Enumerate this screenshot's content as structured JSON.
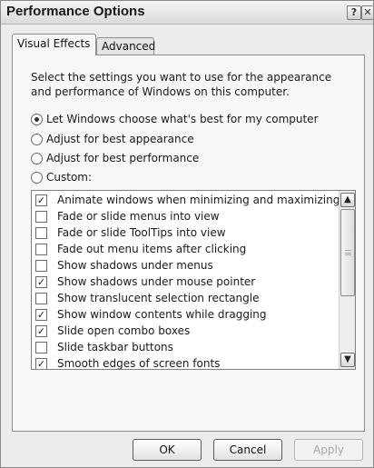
{
  "window": {
    "title": "Performance Options",
    "help_glyph": "?",
    "close_glyph": "✕"
  },
  "tabs": [
    {
      "label": "Visual Effects",
      "active": true
    },
    {
      "label": "Advanced",
      "active": false
    }
  ],
  "visual_effects": {
    "description": "Select the settings you want to use for the appearance and performance of Windows on this computer.",
    "options": [
      {
        "label": "Let Windows choose what's best for my computer",
        "selected": true
      },
      {
        "label": "Adjust for best appearance",
        "selected": false
      },
      {
        "label": "Adjust for best performance",
        "selected": false
      },
      {
        "label": "Custom:",
        "selected": false
      }
    ],
    "effects": [
      {
        "label": "Animate windows when minimizing and maximizing",
        "checked": true
      },
      {
        "label": "Fade or slide menus into view",
        "checked": false
      },
      {
        "label": "Fade or slide ToolTips into view",
        "checked": false
      },
      {
        "label": "Fade out menu items after clicking",
        "checked": false
      },
      {
        "label": "Show shadows under menus",
        "checked": false
      },
      {
        "label": "Show shadows under mouse pointer",
        "checked": true
      },
      {
        "label": "Show translucent selection rectangle",
        "checked": false
      },
      {
        "label": "Show window contents while dragging",
        "checked": true
      },
      {
        "label": "Slide open combo boxes",
        "checked": true
      },
      {
        "label": "Slide taskbar buttons",
        "checked": false
      },
      {
        "label": "Smooth edges of screen fonts",
        "checked": true
      }
    ],
    "scrollbar": {
      "up_glyph": "▲",
      "down_glyph": "▼"
    }
  },
  "buttons": {
    "ok": "OK",
    "cancel": "Cancel",
    "apply": "Apply",
    "apply_enabled": false
  }
}
